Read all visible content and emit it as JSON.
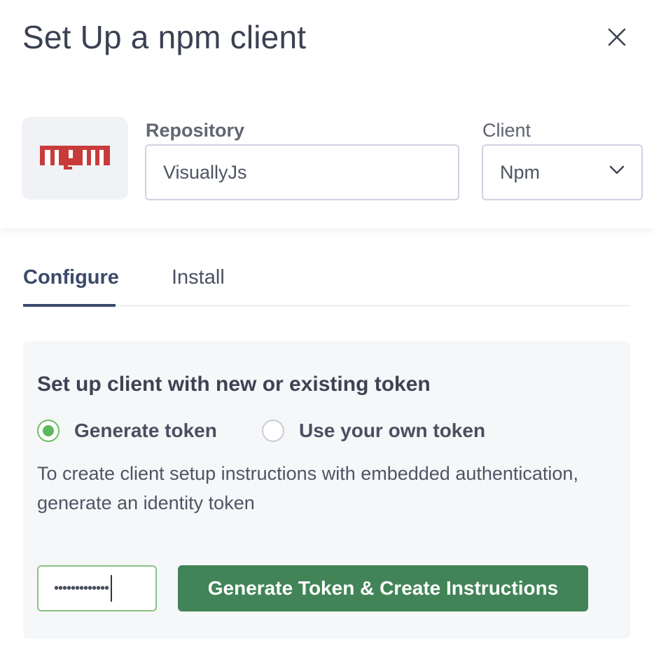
{
  "header": {
    "title": "Set Up a npm client",
    "close_icon": "close-icon"
  },
  "logo": {
    "text": "npm",
    "color": "#c93b3b"
  },
  "repository": {
    "label": "Repository",
    "value": "VisuallyJs"
  },
  "client": {
    "label": "Client",
    "selected": "Npm",
    "icon": "chevron-down-icon"
  },
  "tabs": [
    {
      "label": "Configure",
      "active": true
    },
    {
      "label": "Install",
      "active": false
    }
  ],
  "panel": {
    "heading": "Set up client with new or existing token",
    "options": [
      {
        "label": "Generate token",
        "checked": true
      },
      {
        "label": "Use your own token",
        "checked": false
      }
    ],
    "description": "To create client setup instructions with embedded authentication, generate an identity token",
    "token_input_value": "•••••••••••••",
    "generate_button": "Generate Token & Create Instructions"
  },
  "colors": {
    "accent_green": "#428457",
    "radio_green": "#5cb85c",
    "tab_active": "#3b4a6b"
  }
}
